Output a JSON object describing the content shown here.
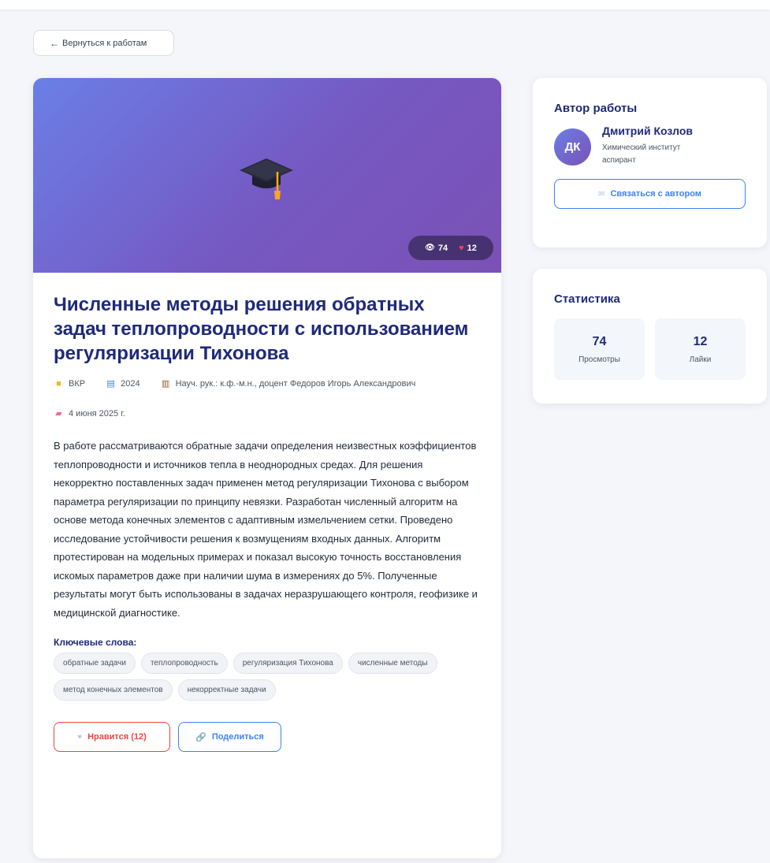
{
  "nav": {
    "back_label": "Вернуться к работам"
  },
  "work": {
    "views": "74",
    "likes": "12",
    "title": "Численные методы решения обратных задач теплопроводности с использованием регуляризации Тихонова",
    "type": "ВКР",
    "year": "2024",
    "supervisor": "Науч. рук.: к.ф.-м.н., доцент Федоров Игорь Александрович",
    "date": "4 июня 2025 г.",
    "abstract": "В работе рассматриваются обратные задачи определения неизвестных коэффициентов теплопроводности и источников тепла в неоднородных средах. Для решения некорректно поставленных задач применен метод регуляризации Тихонова с выбором параметра регуляризации по принципу невязки. Разработан численный алгоритм на основе метода конечных элементов с адаптивным измельчением сетки. Проведено исследование устойчивости решения к возмущениям входных данных. Алгоритм протестирован на модельных примерах и показал высокую точность восстановления искомых параметров даже при наличии шума в измерениях до 5%. Полученные результаты могут быть использованы в задачах неразрушающего контроля, геофизике и медицинской диагностике.",
    "keywords_title": "Ключевые слова:",
    "keywords": [
      "обратные задачи",
      "теплопроводность",
      "регуляризация Тихонова",
      "численные методы",
      "метод конечных элементов",
      "некорректные задачи"
    ],
    "like_button": "Нравится (12)",
    "share_button": "Поделиться"
  },
  "author": {
    "section_title": "Автор работы",
    "initials": "ДК",
    "name": "Дмитрий Козлов",
    "institute": "Химический институт",
    "position": "аспирант",
    "contact_button": "Связаться с автором"
  },
  "stats": {
    "section_title": "Статистика",
    "views_value": "74",
    "views_label": "Просмотры",
    "likes_value": "12",
    "likes_label": "Лайки"
  },
  "icons": {
    "back": "arrow-left-icon",
    "hero": "graduation-cap-icon",
    "views": "eye-icon",
    "likes": "heart-icon",
    "type": "folder-icon",
    "year": "calendar-icon",
    "supervisor": "books-icon",
    "date": "memo-icon",
    "share": "link-icon",
    "contact": "envelope-icon"
  },
  "colors": {
    "primary": "#1e2a78",
    "accent_blue": "#3b82f6",
    "accent_red": "#ef4444",
    "hero_gradient_start": "#6a7fe6",
    "hero_gradient_end": "#7a52b5"
  }
}
